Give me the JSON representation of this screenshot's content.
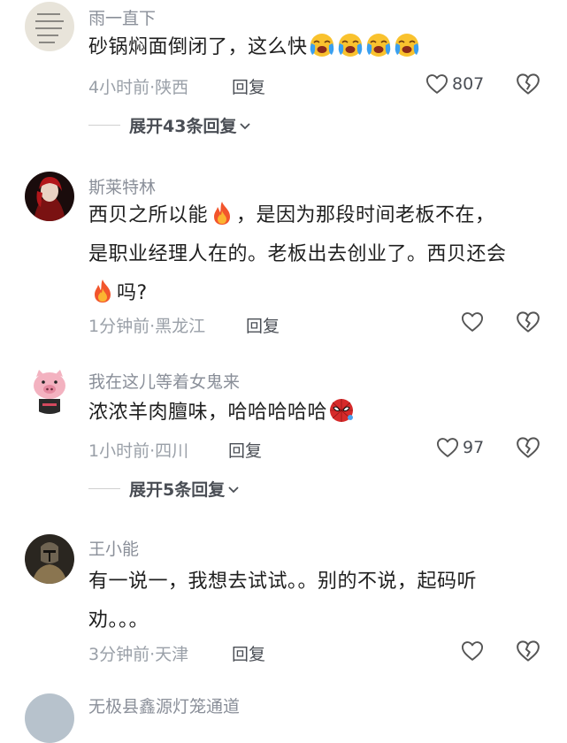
{
  "comments": [
    {
      "username": "雨一直下",
      "content": [
        "砂锅焖面倒闭了，这么快"
      ],
      "time_location": "4小时前·陕西",
      "reply_label": "回复",
      "likes": "807",
      "expand_label": "展开43条回复"
    },
    {
      "username": "斯莱特林",
      "content": [
        "西贝之所以能",
        "，是因为那段时间老板不在，",
        "是职业经理人在的。老板出去创业了。西贝还会",
        "吗?"
      ],
      "time_location": "1分钟前·黑龙江",
      "reply_label": "回复",
      "likes": ""
    },
    {
      "username": "我在这儿等着女鬼来",
      "content": [
        "浓浓羊肉膻味，哈哈哈哈哈"
      ],
      "time_location": "1小时前·四川",
      "reply_label": "回复",
      "likes": "97",
      "expand_label": "展开5条回复"
    },
    {
      "username": "王小能",
      "content": [
        "有一说一，我想去试试。。别的不说，起码听",
        "劝。。。"
      ],
      "time_location": "3分钟前·天津",
      "reply_label": "回复",
      "likes": ""
    },
    {
      "username": "无极县鑫源灯笼通道"
    }
  ],
  "icons": {
    "like": "heart-outline-icon",
    "dislike": "broken-heart-icon",
    "expand": "chevron-down-icon",
    "emoji_crying": "loudly-crying-face-emoji",
    "emoji_fire": "fire-emoji",
    "emoji_spider": "spider-mask-emoji"
  },
  "colors": {
    "text_primary": "#1f1f1f",
    "text_secondary": "#9aa0a8",
    "username": "#8a8f99"
  }
}
